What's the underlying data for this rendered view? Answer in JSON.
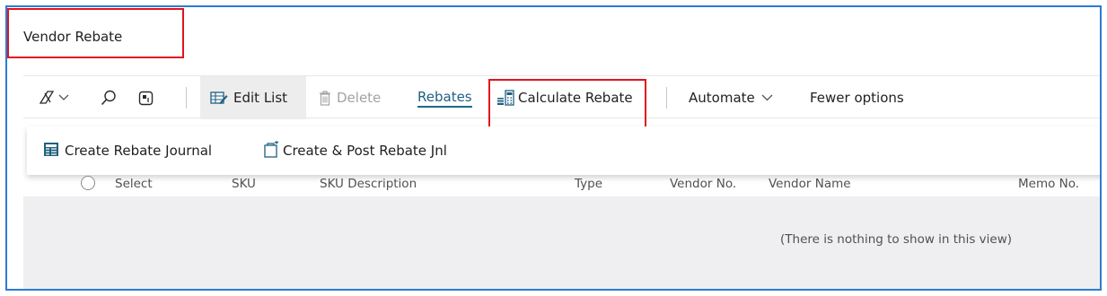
{
  "page": {
    "title": "Vendor Rebate"
  },
  "action_bar": {
    "edit_list": "Edit List",
    "delete": "Delete",
    "rebates": "Rebates",
    "calculate_rebate": "Calculate Rebate",
    "automate": "Automate",
    "fewer_options": "Fewer options"
  },
  "submenu": {
    "create_rebate_journal": "Create Rebate Journal",
    "create_post_rebate_jnl": "Create & Post Rebate Jnl"
  },
  "table": {
    "columns": [
      "Select",
      "SKU",
      "SKU Description",
      "Type",
      "Vendor No.",
      "Vendor Name",
      "Memo No."
    ],
    "empty_message": "(There is nothing to show in this view)"
  },
  "colors": {
    "accent": "#2b7cd3",
    "highlight": "#e0141e",
    "link": "#1f5f7f"
  },
  "icons": [
    "filter-pane-icon",
    "chevron-down-icon",
    "search-icon",
    "share-icon",
    "edit-list-icon",
    "delete-icon",
    "calculate-icon",
    "journal-icon",
    "post-journal-icon"
  ]
}
